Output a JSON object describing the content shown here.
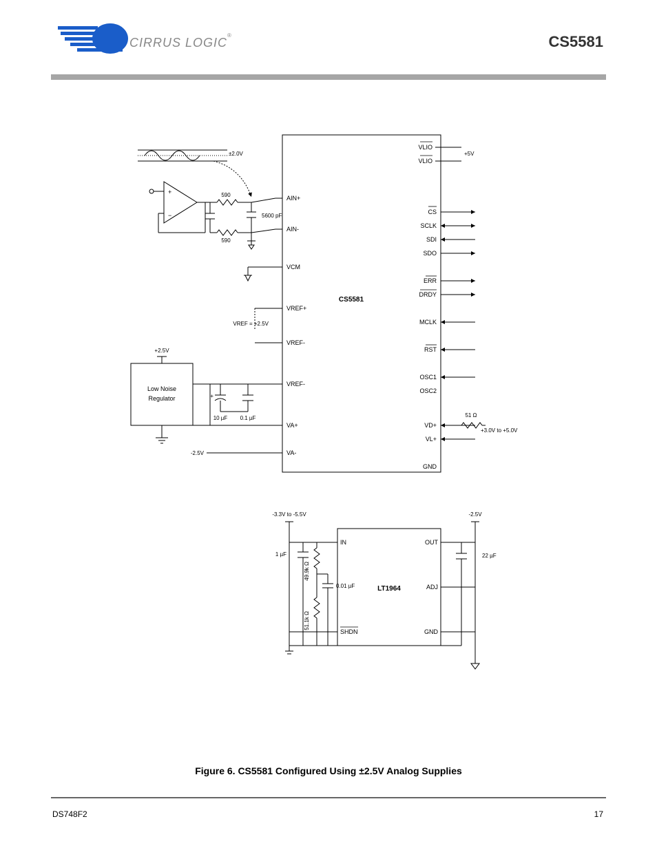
{
  "header": {
    "brand": "CIRRUS LOGIC",
    "reg": "®",
    "part": "CS5581"
  },
  "caption": "Figure 6.  CS5581 Configured Using ±2.5V Analog Supplies",
  "footer": {
    "left": "DS748F2",
    "right": "17"
  },
  "main": {
    "chip": "CS5581",
    "left_pins": {
      "ainp": "AIN+",
      "ainm": "AIN-",
      "vcm": "VCM",
      "vrefp": "VREF+",
      "vrefm": "VREF-",
      "vrefm2": "VREF-",
      "va_plus": "VA+",
      "va_minus": "VA-"
    },
    "right_pins": {
      "vlio": "VLIO",
      "cs": "CS",
      "sclk": "SCLK",
      "sdi": "SDI",
      "sdo": "SDO",
      "err": "ERR",
      "drdy": "DRDY",
      "mclk": "MCLK",
      "rst": "RST",
      "osc1": "OSC1",
      "osc2": "OSC2",
      "vd": "VD+",
      "vl": "VL+",
      "gnd": "GND"
    },
    "values": {
      "r_in": "590",
      "c_ain": "5600 pF",
      "c_10u": "10 µF",
      "c_01u": "0.1 µF",
      "reg": "Low Noise Regulator",
      "vbat": "+2.5V",
      "vneg": "-2.5V",
      "range": "±2.0V",
      "vref_plate": "VREF = +2.5V",
      "osc_r": "51 Ω",
      "vd_to_vl": "+3.0V  to +5.0V",
      "v5": "+5V"
    }
  },
  "power": {
    "chip": "LT1964",
    "pins": {
      "in": "IN",
      "shdn": "SHDN",
      "out": "OUT",
      "adj": "ADJ",
      "gnd": "GND"
    },
    "values": {
      "vin": "-3.3V to  -5.5V",
      "out": "-2.5V",
      "r1": "49.9k Ω",
      "r2": "51.1k Ω",
      "c1u": "1 µF",
      "c01u": "0.01 µF",
      "c22u": "22 µF"
    }
  }
}
